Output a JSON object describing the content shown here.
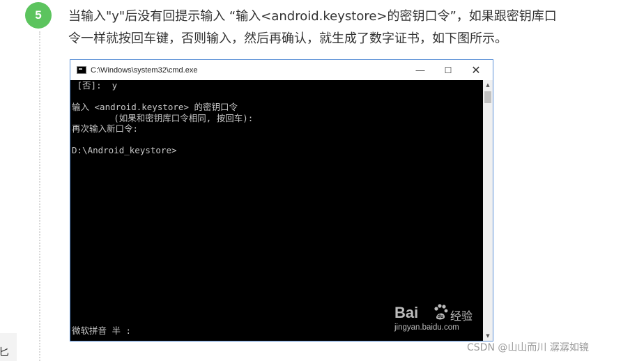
{
  "step": {
    "number": "5",
    "text_line1": "当输入\"y\"后没有回提示输入 “输入<android.keystore>的密钥口令”，如果跟密钥库口",
    "text_line2": "令一样就按回车键，否则输入，然后再确认，就生成了数字证书，如下图所示。"
  },
  "cmd_window": {
    "title": "C:\\Windows\\system32\\cmd.exe",
    "icon": "cmd-icon",
    "controls": {
      "minimize": "—",
      "maximize": "☐",
      "close": "✕"
    },
    "lines": [
      " [否]:  y",
      "",
      "输入 <android.keystore> 的密钥口令",
      "        (如果和密钥库口令相同, 按回车):",
      "再次输入新口令:",
      "",
      "D:\\Android_keystore>"
    ],
    "ime_status": "微软拼音 半 :"
  },
  "watermarks": {
    "baidu_logo_text": "Bai",
    "baidu_logo_suffix": "经验",
    "baidu_url": "jingyan.baidu.com",
    "csdn": "CSDN @山山而川 潺潺如镜"
  },
  "left_edge_char": "匕",
  "colors": {
    "badge": "#5cc45e",
    "console_bg": "#000000",
    "console_text": "#c8c8c8"
  }
}
